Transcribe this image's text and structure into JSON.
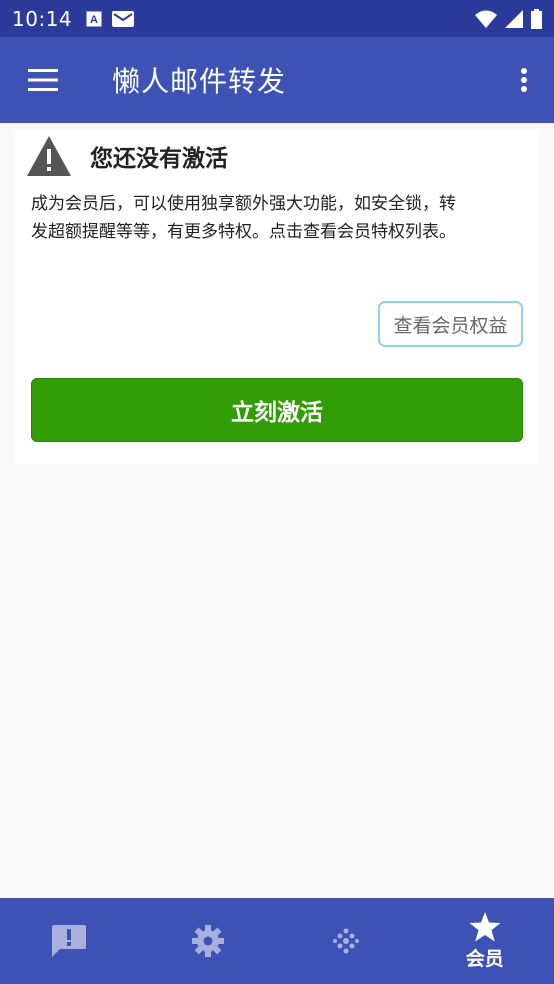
{
  "status_bar": {
    "time": "10:14"
  },
  "app_bar": {
    "title": "懒人邮件转发"
  },
  "card": {
    "title": "您还没有激活",
    "description": "成为会员后，可以使用独享额外强大功能，如安全锁，转发超额提醒等等，有更多特权。点击查看会员特权列表。",
    "benefits_button": "查看会员权益",
    "activate_button": "立刻激活"
  },
  "bottom_nav": {
    "items": [
      {
        "icon": "feedback-icon"
      },
      {
        "icon": "gear-icon"
      },
      {
        "icon": "dots-icon"
      },
      {
        "icon": "star-icon",
        "label": "会员",
        "active": true
      }
    ]
  },
  "colors": {
    "primary": "#3e51b5",
    "status_bar": "#2c3b9b",
    "activate": "#329c06",
    "outline": "#90d0f0"
  }
}
